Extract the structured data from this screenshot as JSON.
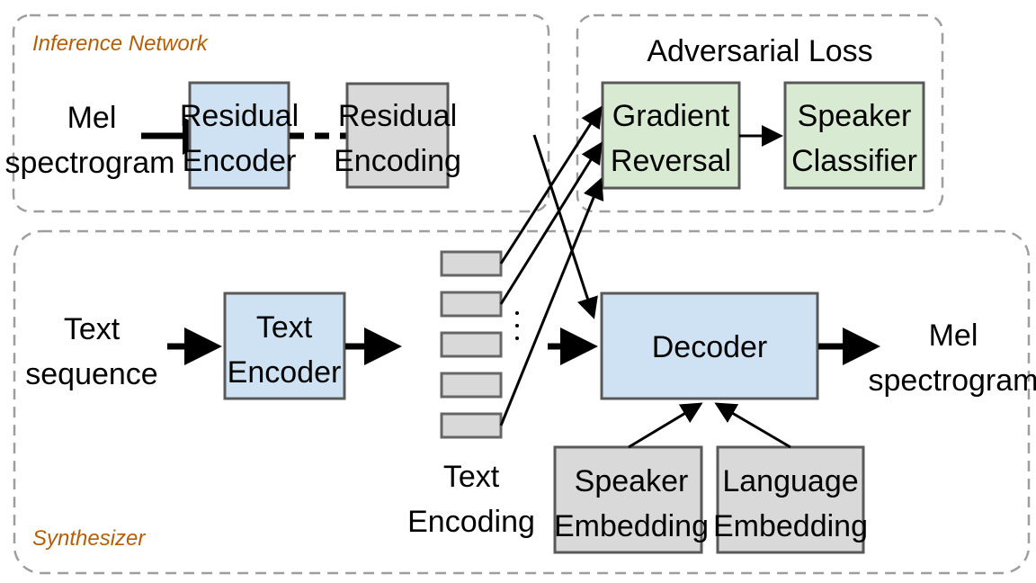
{
  "groups": {
    "inference_network": "Inference Network",
    "adversarial_loss": "Adversarial Loss",
    "synthesizer": "Synthesizer"
  },
  "inputs": {
    "mel_in": [
      "Mel",
      "spectrogram"
    ],
    "text_in": [
      "Text",
      "sequence"
    ]
  },
  "blocks": {
    "residual_encoder": [
      "Residual",
      "Encoder"
    ],
    "residual_encoding": [
      "Residual",
      "Encoding"
    ],
    "gradient_reversal": [
      "Gradient",
      "Reversal"
    ],
    "speaker_classifier": [
      "Speaker",
      "Classifier"
    ],
    "text_encoder": [
      "Text",
      "Encoder"
    ],
    "decoder": "Decoder",
    "speaker_embedding": [
      "Speaker",
      "Embedding"
    ],
    "language_embedding": [
      "Language",
      "Embedding"
    ]
  },
  "text_encoding": {
    "label": [
      "Text",
      "Encoding"
    ],
    "cell_count": 5,
    "ellipsis": "⋮"
  },
  "outputs": {
    "mel_out": [
      "Mel",
      "spectrogram"
    ]
  },
  "colors": {
    "encoder_fill": "#cfe2f3",
    "embedding_fill": "#d9d9d9",
    "adversarial_fill": "#d9ead3",
    "group_label": "#b45f06"
  }
}
